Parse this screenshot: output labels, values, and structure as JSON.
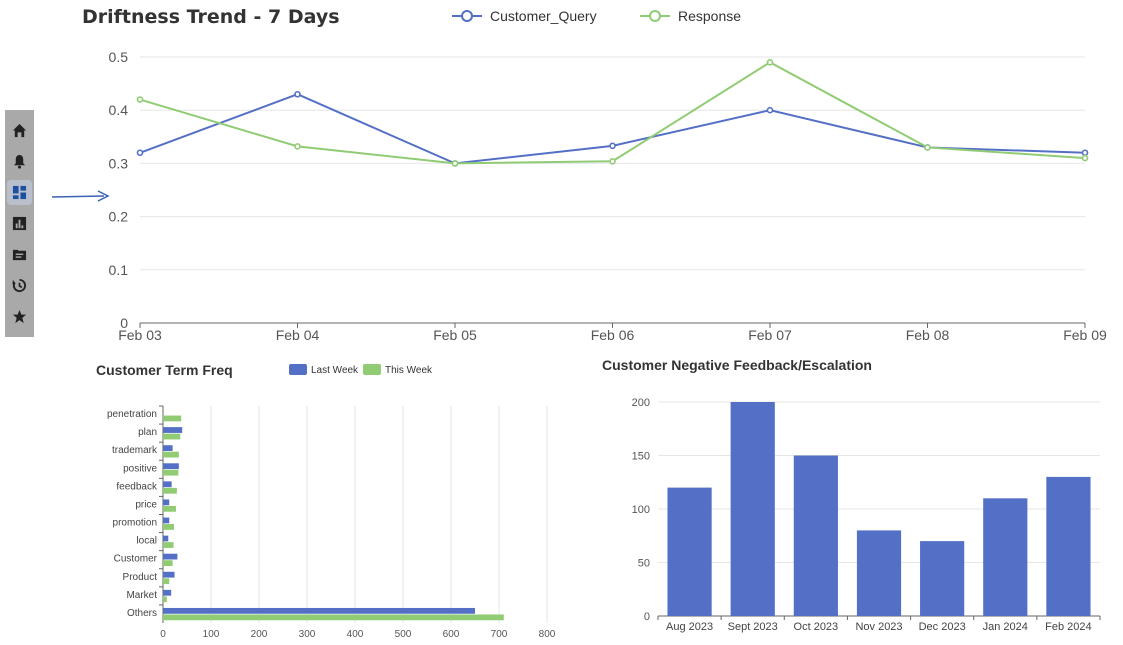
{
  "sidebar": {
    "items": [
      {
        "icon": "home-icon"
      },
      {
        "icon": "bell-icon"
      },
      {
        "icon": "dashboard-icon",
        "active": true
      },
      {
        "icon": "bar-chart-icon"
      },
      {
        "icon": "message-icon"
      },
      {
        "icon": "history-icon"
      },
      {
        "icon": "star-icon"
      }
    ],
    "accent": "#1f4fa0"
  },
  "chart_data": [
    {
      "type": "line",
      "title": "Driftness Trend - 7 Days",
      "categories": [
        "Feb 03",
        "Feb 04",
        "Feb 05",
        "Feb 06",
        "Feb 07",
        "Feb 08",
        "Feb 09"
      ],
      "series": [
        {
          "name": "Customer_Query",
          "color": "#5470c6",
          "values": [
            0.32,
            0.43,
            0.3,
            0.333,
            0.4,
            0.33,
            0.32
          ]
        },
        {
          "name": "Response",
          "color": "#91cc75",
          "values": [
            0.42,
            0.332,
            0.3,
            0.304,
            0.49,
            0.33,
            0.31
          ]
        }
      ],
      "ylim": [
        0,
        0.5
      ],
      "yticks": [
        "0",
        "0.1",
        "0.2",
        "0.3",
        "0.4",
        "0.5"
      ],
      "grid": true,
      "legend": "top-center"
    },
    {
      "type": "bar",
      "orientation": "horizontal",
      "title": "Customer Term Freq",
      "categories": [
        "penetration",
        "plan",
        "trademark",
        "positive",
        "feedback",
        "price",
        "promotion",
        "local",
        "Customer",
        "Product",
        "Market",
        "Others"
      ],
      "series": [
        {
          "name": "Last Week",
          "color": "#5470c6",
          "values": [
            0,
            40,
            20,
            33,
            18,
            13,
            13,
            11,
            30,
            24,
            17,
            650
          ]
        },
        {
          "name": "This Week",
          "color": "#91cc75",
          "values": [
            38,
            36,
            33,
            32,
            29,
            27,
            23,
            22,
            20,
            13,
            8,
            710
          ]
        }
      ],
      "xlim": [
        0,
        800
      ],
      "xticks": [
        "0",
        "100",
        "200",
        "300",
        "400",
        "500",
        "600",
        "700",
        "800"
      ],
      "grid": true,
      "legend": "top-center"
    },
    {
      "type": "bar",
      "title": "Customer Negative Feedback/Escalation",
      "categories": [
        "Aug 2023",
        "Sept 2023",
        "Oct 2023",
        "Nov 2023",
        "Dec 2023",
        "Jan 2024",
        "Feb 2024"
      ],
      "values": [
        120,
        200,
        150,
        80,
        70,
        110,
        130
      ],
      "color": "#5470c6",
      "ylim": [
        0,
        200
      ],
      "yticks": [
        "0",
        "50",
        "100",
        "150",
        "200"
      ],
      "grid": true
    }
  ]
}
